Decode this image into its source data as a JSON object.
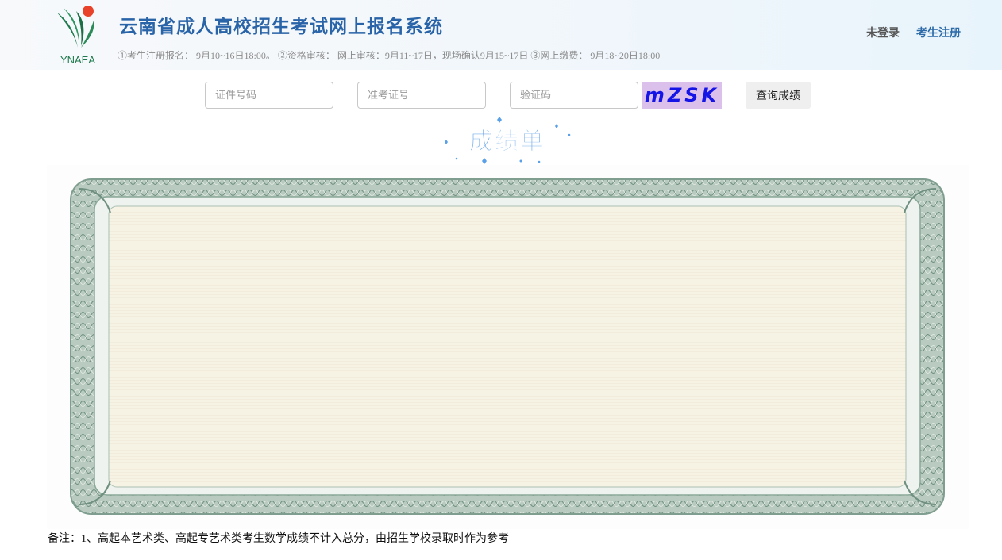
{
  "header": {
    "logo_text": "YNAEA",
    "title": "云南省成人高校招生考试网上报名系统",
    "schedule": "①考生注册报名：  9月10~16日18:00。 ②资格审核：  网上审核：9月11~17日，现场确认9月15~17日 ③网上缴费：  9月18~20日18:00",
    "nav": {
      "not_logged_in": "未登录",
      "register": "考生注册"
    }
  },
  "search": {
    "id_placeholder": "证件号码",
    "exam_no_placeholder": "准考证号",
    "captcha_placeholder": "验证码",
    "captcha_text": "mZSK",
    "query_button": "查询成绩"
  },
  "score_banner": {
    "title": "成绩单"
  },
  "note": "备注：1、高起本艺术类、高起专艺术类考生数学成绩不计入总分，由招生学校录取时作为参考",
  "colors": {
    "title_blue": "#2a64a8",
    "register_blue": "#2c6aa8",
    "captcha_bg": "#dcc0ec",
    "captcha_text": "#1414e6",
    "certificate_border": "#8aa898",
    "certificate_paper": "#f8f4e6"
  }
}
